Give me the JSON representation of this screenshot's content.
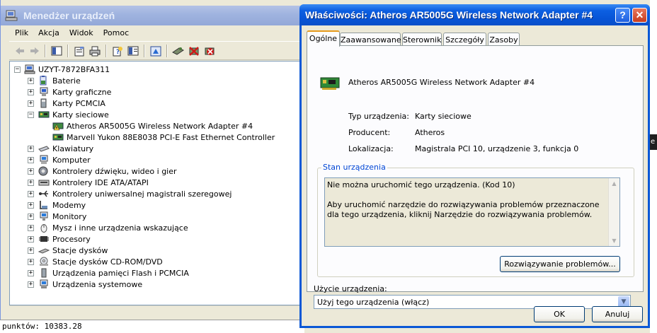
{
  "device_manager": {
    "title": "Menedżer urządzeń",
    "menu": [
      "Plik",
      "Akcja",
      "Widok",
      "Pomoc"
    ],
    "toolbar_icons": [
      "back-arrow-icon",
      "forward-arrow-icon",
      "console-tree-icon",
      "properties-icon",
      "print-icon",
      "help-icon",
      "view-icon",
      "refresh-icon",
      "scan-hardware-icon",
      "disable-device-icon",
      "uninstall-device-icon"
    ],
    "tree": {
      "root": "UZYT-7872BFA311",
      "categories": [
        {
          "label": "Baterie",
          "icon": "battery-icon",
          "expanded": false
        },
        {
          "label": "Karty graficzne",
          "icon": "display-adapter-icon",
          "expanded": false
        },
        {
          "label": "Karty PCMCIA",
          "icon": "pcmcia-icon",
          "expanded": false
        },
        {
          "label": "Karty sieciowe",
          "icon": "network-adapter-icon",
          "expanded": true,
          "children": [
            "Atheros AR5005G Wireless Network Adapter #4",
            "Marvell Yukon 88E8038 PCI-E Fast Ethernet Controller"
          ]
        },
        {
          "label": "Klawiatury",
          "icon": "keyboard-icon",
          "expanded": false
        },
        {
          "label": "Komputer",
          "icon": "computer-icon",
          "expanded": false
        },
        {
          "label": "Kontrolery dźwięku, wideo i gier",
          "icon": "sound-icon",
          "expanded": false
        },
        {
          "label": "Kontrolery IDE ATA/ATAPI",
          "icon": "ide-icon",
          "expanded": false
        },
        {
          "label": "Kontrolery uniwersalnej magistrali szeregowej",
          "icon": "usb-icon",
          "expanded": false
        },
        {
          "label": "Modemy",
          "icon": "modem-icon",
          "expanded": false
        },
        {
          "label": "Monitory",
          "icon": "monitor-icon",
          "expanded": false
        },
        {
          "label": "Mysz i inne urządzenia wskazujące",
          "icon": "mouse-icon",
          "expanded": false
        },
        {
          "label": "Procesory",
          "icon": "processor-icon",
          "expanded": false
        },
        {
          "label": "Stacje dysków",
          "icon": "disk-drive-icon",
          "expanded": false
        },
        {
          "label": "Stacje dysków CD-ROM/DVD",
          "icon": "cdrom-icon",
          "expanded": false
        },
        {
          "label": "Urządzenia pamięci Flash i PCMCIA",
          "icon": "flash-memory-icon",
          "expanded": false
        },
        {
          "label": "Urządzenia systemowe",
          "icon": "system-device-icon",
          "expanded": false
        }
      ]
    }
  },
  "background_text": "punktów: 10383.28",
  "edge_text": "e",
  "dialog": {
    "title": "Właściwości: Atheros AR5005G Wireless Network Adapter #4",
    "help_label": "?",
    "close_label": "✕",
    "tabs": [
      "Ogólne",
      "Zaawansowane",
      "Sterownik",
      "Szczegóły",
      "Zasoby"
    ],
    "active_tab": "Ogólne",
    "device_name": "Atheros AR5005G Wireless Network Adapter #4",
    "properties": [
      {
        "label": "Typ urządzenia:",
        "value": "Karty sieciowe"
      },
      {
        "label": "Producent:",
        "value": "Atheros"
      },
      {
        "label": "Lokalizacja:",
        "value": "Magistrala PCI 10, urządzenie 3, funkcja 0"
      }
    ],
    "status_group_title": "Stan urządzenia",
    "status_line1": "Nie można uruchomić tego urządzenia. (Kod 10)",
    "status_line2": "Aby uruchomić narzędzie do rozwiązywania problemów przeznaczone dla tego urządzenia, kliknij Narzędzie do rozwiązywania problemów.",
    "troubleshoot_label": "Rozwiązywanie problemów...",
    "usage_label": "Użycie urządzenia:",
    "usage_value": "Użyj tego urządzenia (włącz)",
    "ok_label": "OK",
    "cancel_label": "Anuluj"
  }
}
